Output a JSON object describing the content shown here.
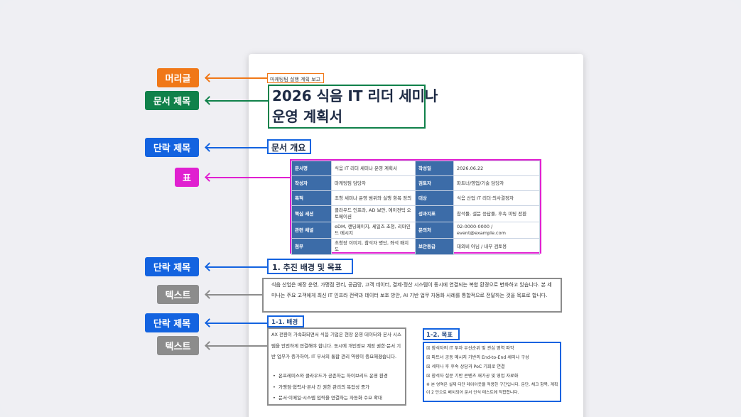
{
  "labels": {
    "header": "머리글",
    "doc_title": "문서 제목",
    "section_title": "단락 제목",
    "table": "표",
    "text": "텍스트"
  },
  "colors": {
    "orange": "#f07818",
    "green": "#10814a",
    "blue": "#1363e0",
    "magenta": "#e020d0",
    "gray": "#8c8c8c"
  },
  "document": {
    "header": "마케팅팀 실행 계획 보고",
    "title_line1": "2026 식음 IT 리더 세미나",
    "title_line2": "운영 계획서",
    "overview_title": "문서 개요",
    "table": [
      [
        "문서명",
        "식음 IT 리더 세미나 운영 계획서",
        "작성일",
        "2026.06.22"
      ],
      [
        "작성자",
        "마케팅팀 담당자",
        "검토자",
        "파트너/영업/기술 담당자"
      ],
      [
        "목적",
        "초청 세미나 운영 범위와 실행 항목 정의",
        "대상",
        "식음 산업 IT 리더·의사결정자"
      ],
      [
        "핵심 세션",
        "클라우드 인프라, AD 보안, 에이전틱 오토메이션",
        "성과지표",
        "참석률, 설문 응답률, 후속 미팅 전환"
      ],
      [
        "관련 채널",
        "eDM, 랜딩페이지, 세일즈 초청, 리마인드 메시지",
        "문의처",
        "02-0000-0000 / event@example.com"
      ],
      [
        "첨부",
        "초청장 이미지, 참석자 명단, 좌석 배치도",
        "보안등급",
        "대외비 아님 / 내부 검토용"
      ]
    ],
    "section1_title": "1. 추진 배경 및 목표",
    "section1_text": "식음 산업은 매장 운영, 가맹점 관리, 공급망, 고객 데이터, 결제·정산 시스템이 동시에 연결되는 복합 환경으로 변화하고 있습니다. 본 세미나는 주요 고객에게 최신 IT 인프라 전략과 데이터 보호 방안, AI 기반 업무 자동화 사례를 통합적으로 전달하는 것을 목표로 합니다.",
    "sub1_title": "1-1. 배경",
    "sub1_text": "AX 전환이 가속화되면서 식음 기업은 현장 운영 데이터와 본사 시스템을 안전하게 연결해야 합니다. 동시에 개인정보 계정 권한·문서 기반 업무가 증가하여, IT 부서의 통합 관리 역량이 중요해졌습니다.",
    "sub1_bullets": [
      "온프레미스와 클라우드가 공존하는 하이브리드 운영 환경",
      "가맹점·협력사·본사 간 권한 관리의 복잡성 증가",
      "문서·이메일·시스템 입력을 연결하는 자동화 수요 확대"
    ],
    "sub2_title": "1-2. 목표",
    "sub2_items": [
      "☒ 참석자의 IT 투자 우선순위 및 관심 영역 파악",
      "☒ 파트너 공동 메시지 기반의 End-to-End 세미나 구성",
      "☒ 세미나 후 후속 상담과 PoC 기회로 연결",
      "☒ 참석자 설문 기반 콘텐츠 재가공 및 영업 자료화"
    ],
    "sub2_note": "※ 본 영역은 실제 다단 레이아웃을 적용한 구간입니다. 문단, 체크 항목, 계획이 2 단으로 배치되어 문서 인식 테스트에 적합합니다."
  }
}
